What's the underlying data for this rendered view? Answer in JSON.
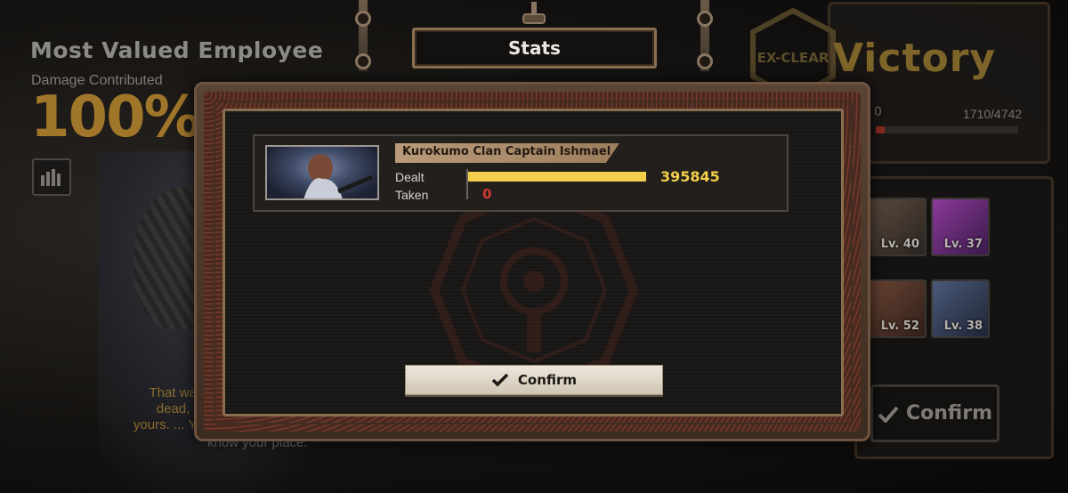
{
  "background": {
    "mve_title": "Most Valued Employee",
    "damage_label": "Damage Contributed",
    "damage_value": "100%",
    "quote_lines": [
      "That was disa",
      "dead, looks l",
      "yours. ... You wo"
    ],
    "quote_tail": "know your place.",
    "victory_text": "Victory",
    "emblem_text": "EX-CLEAR",
    "exp_text": "1710/4742",
    "exp_left": "0",
    "exp_fraction": 0.06,
    "team": [
      {
        "level": "Lv. 40"
      },
      {
        "level": "Lv. 37"
      },
      {
        "level": "Lv. 52"
      },
      {
        "level": "Lv. 38"
      }
    ],
    "confirm_label": "Confirm"
  },
  "modal": {
    "title": "Stats",
    "unit": {
      "name": "Kurokumo Clan Captain Ishmael",
      "dealt_label": "Dealt",
      "taken_label": "Taken",
      "dealt_value": "395845",
      "taken_value": "0",
      "dealt_fraction": 1.0,
      "taken_fraction": 0.0
    },
    "confirm_label": "Confirm"
  },
  "colors": {
    "dealt_bar": "#f3cf4b",
    "taken_bar": "#d03a2f",
    "frame": "#8a6e50"
  }
}
